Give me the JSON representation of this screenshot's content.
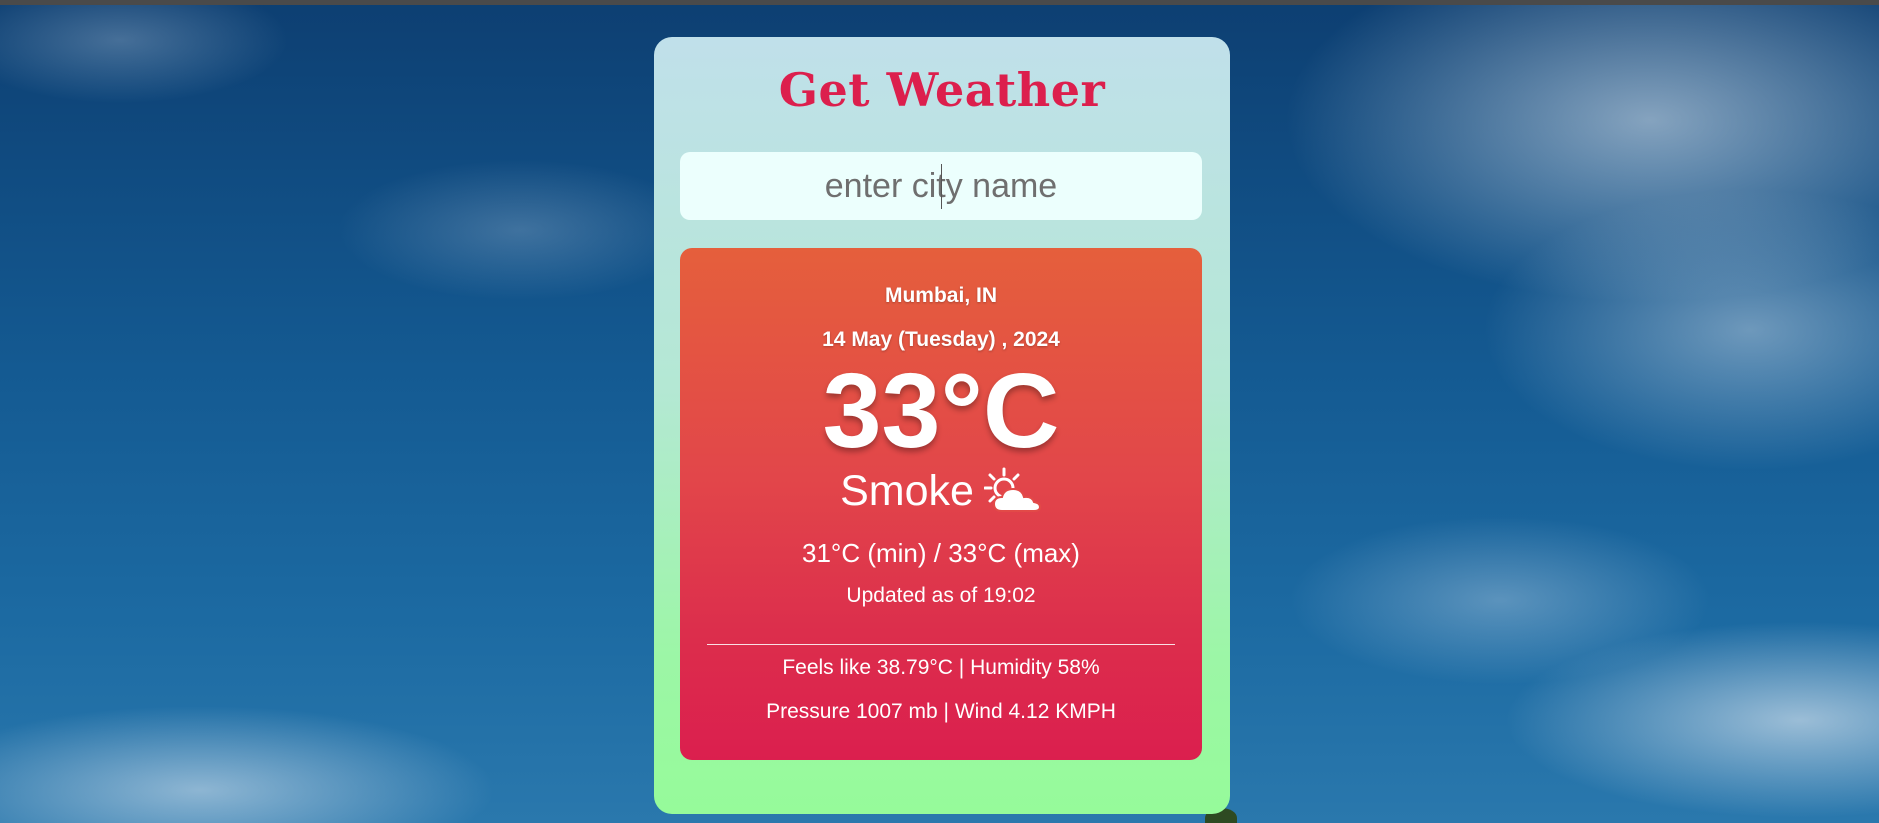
{
  "app": {
    "title": "Get Weather"
  },
  "search": {
    "placeholder": "enter city name",
    "value": ""
  },
  "weather": {
    "location": "Mumbai, IN",
    "date": "14 May (Tuesday) , 2024",
    "temperature": "33°C",
    "condition": "Smoke",
    "condition_icon": "sun-behind-cloud-icon",
    "min_max": "31°C (min) / 33°C (max)",
    "updated": "Updated as of 19:02",
    "feels_humidity": "Feels like 38.79°C | Humidity 58%",
    "pressure_wind": "Pressure 1007 mb | Wind 4.12 KMPH"
  },
  "colors": {
    "title": "#dc1f4d",
    "card_top": "#c0e0ea",
    "card_bottom": "#96fb9a",
    "weather_top": "#e55f3c",
    "weather_bottom": "#db1f4e",
    "input_bg": "#ecfffd"
  }
}
